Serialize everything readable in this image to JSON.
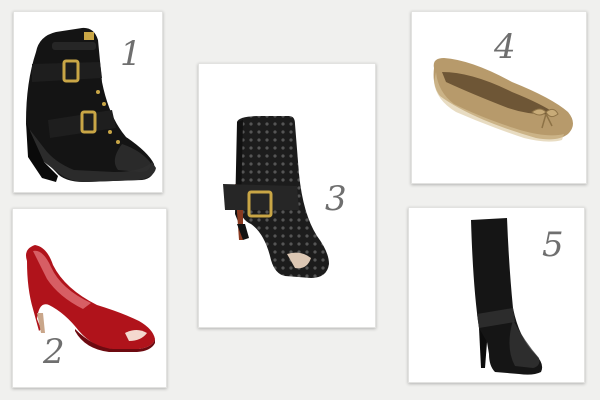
{
  "products": [
    {
      "number": "1",
      "icon": "wedge-sneaker-icon",
      "color": "#151515"
    },
    {
      "number": "2",
      "icon": "peep-toe-pump-icon",
      "color": "#b0131b"
    },
    {
      "number": "3",
      "icon": "perforated-bootie-icon",
      "color": "#1c1c1c"
    },
    {
      "number": "4",
      "icon": "ballet-flat-icon",
      "color": "#b79a6b"
    },
    {
      "number": "5",
      "icon": "knee-boot-icon",
      "color": "#151515"
    }
  ]
}
